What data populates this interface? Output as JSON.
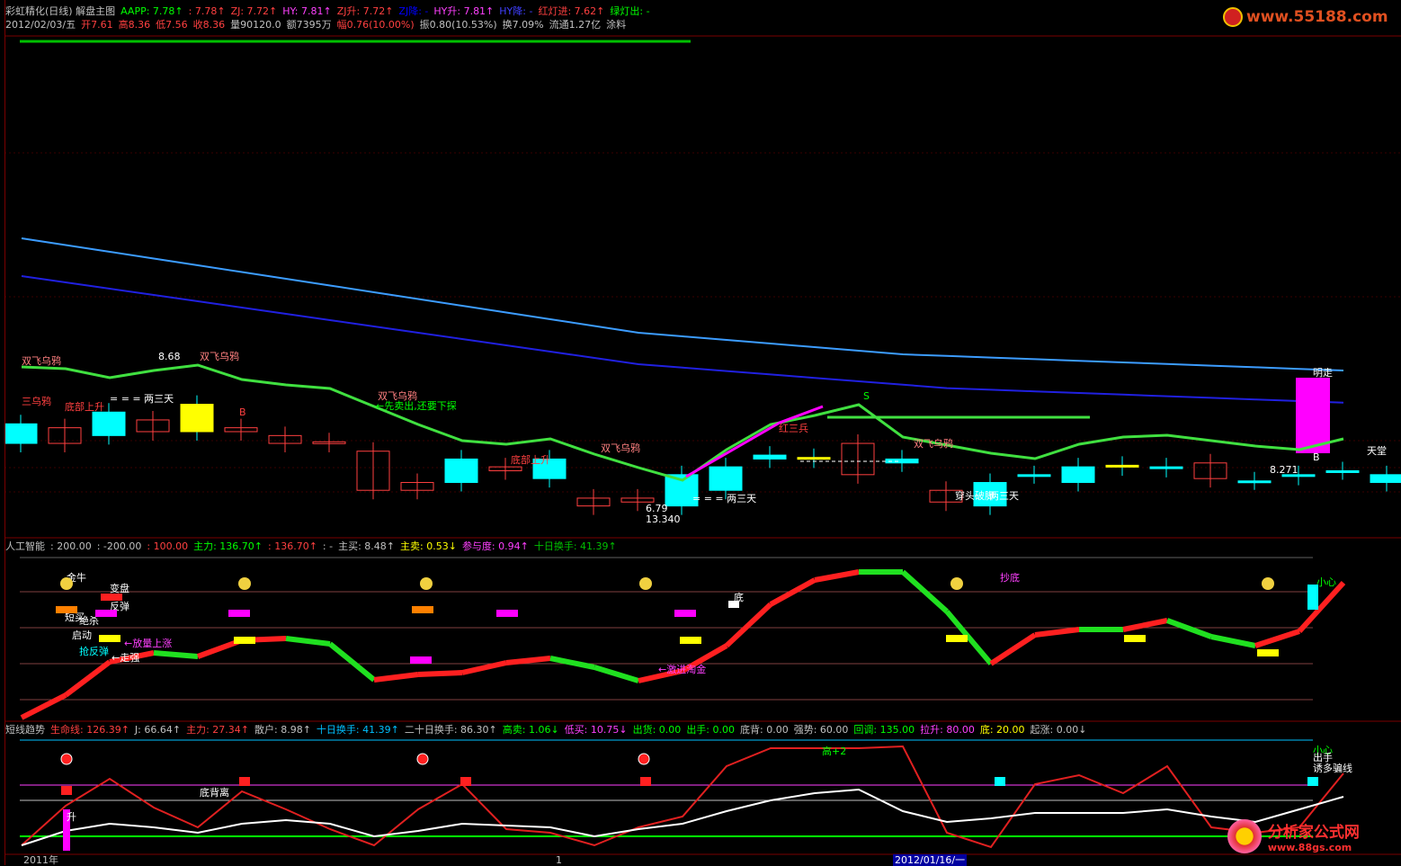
{
  "header": {
    "row1": [
      {
        "text": "彩虹精化(日线) 解盘主图",
        "color": "#c0c0c0"
      },
      {
        "text": "AAPP: 7.78↑",
        "color": "#00ff00"
      },
      {
        "text": ": 7.78↑",
        "color": "#ff4040"
      },
      {
        "text": "ZJ: 7.72↑",
        "color": "#ff4040"
      },
      {
        "text": "HY: 7.81↑",
        "color": "#ff40ff"
      },
      {
        "text": "ZJ升: 7.72↑",
        "color": "#ff4040"
      },
      {
        "text": "ZJ降: -",
        "color": "#0000ff"
      },
      {
        "text": "HY升: 7.81↑",
        "color": "#ff40ff"
      },
      {
        "text": "HY降: -",
        "color": "#4040ff"
      },
      {
        "text": "红灯进: 7.62↑",
        "color": "#ff4040"
      },
      {
        "text": "绿灯出: -",
        "color": "#00ff00"
      }
    ],
    "row2": [
      {
        "text": "2012/02/03/五",
        "color": "#c0c0c0"
      },
      {
        "text": "开7.61",
        "color": "#ff4040"
      },
      {
        "text": "高8.36",
        "color": "#ff4040"
      },
      {
        "text": "低7.56",
        "color": "#ff4040"
      },
      {
        "text": "收8.36",
        "color": "#ff4040"
      },
      {
        "text": "量90120.0",
        "color": "#c0c0c0"
      },
      {
        "text": "额7395万",
        "color": "#c0c0c0"
      },
      {
        "text": "幅0.76(10.00%)",
        "color": "#ff4040"
      },
      {
        "text": "振0.80(10.53%)",
        "color": "#c0c0c0"
      },
      {
        "text": "换7.09%",
        "color": "#c0c0c0"
      },
      {
        "text": "流通1.27亿",
        "color": "#c0c0c0"
      },
      {
        "text": "涂料",
        "color": "#c0c0c0"
      }
    ]
  },
  "panel2_header": [
    {
      "text": "人工智能",
      "color": "#c0c0c0"
    },
    {
      "text": ": 200.00",
      "color": "#c0c0c0"
    },
    {
      "text": ": -200.00",
      "color": "#c0c0c0"
    },
    {
      "text": ": 100.00",
      "color": "#ff4040"
    },
    {
      "text": "主力: 136.70↑",
      "color": "#00ff00"
    },
    {
      "text": ": 136.70↑",
      "color": "#ff4040"
    },
    {
      "text": ": -",
      "color": "#c0c0c0"
    },
    {
      "text": "主买: 8.48↑",
      "color": "#c0c0c0"
    },
    {
      "text": "主卖: 0.53↓",
      "color": "#ffff00"
    },
    {
      "text": "参与度: 0.94↑",
      "color": "#ff40ff"
    },
    {
      "text": "十日换手: 41.39↑",
      "color": "#00c000"
    }
  ],
  "panel3_header": [
    {
      "text": "短线趋势",
      "color": "#c0c0c0"
    },
    {
      "text": "生命线: 126.39↑",
      "color": "#ff4040"
    },
    {
      "text": "J: 66.64↑",
      "color": "#c0c0c0"
    },
    {
      "text": "主力: 27.34↑",
      "color": "#ff4040"
    },
    {
      "text": "散户: 8.98↑",
      "color": "#c0c0c0"
    },
    {
      "text": "十日换手: 41.39↑",
      "color": "#00c0ff"
    },
    {
      "text": "二十日换手: 86.30↑",
      "color": "#c0c0c0"
    },
    {
      "text": "高卖: 1.06↓",
      "color": "#00ff00"
    },
    {
      "text": "低买: 10.75↓",
      "color": "#ff40ff"
    },
    {
      "text": "出货: 0.00",
      "color": "#00ff00"
    },
    {
      "text": "出手: 0.00",
      "color": "#00ff00"
    },
    {
      "text": "底背: 0.00",
      "color": "#c0c0c0"
    },
    {
      "text": "强势: 60.00",
      "color": "#c0c0c0"
    },
    {
      "text": "回调: 135.00",
      "color": "#00ff00"
    },
    {
      "text": "拉升: 80.00",
      "color": "#ff40ff"
    },
    {
      "text": "底: 20.00",
      "color": "#ffff00"
    },
    {
      "text": "起涨: 0.00↓",
      "color": "#c0c0c0"
    }
  ],
  "watermark_top": "www.55188.com",
  "watermark_bottom": {
    "cn": "分析家公式网",
    "url": "www.88gs.com"
  },
  "axis_labels": {
    "left": "2011年",
    "mid": "1",
    "date": "2012/01/16/一"
  },
  "chart_data": {
    "type": "candlestick",
    "candles": [
      {
        "o": 7.6,
        "c": 7.85
      },
      {
        "o": 7.8,
        "c": 7.6
      },
      {
        "o": 7.7,
        "c": 8.0
      },
      {
        "o": 7.9,
        "c": 7.75
      },
      {
        "o": 7.75,
        "c": 8.1
      },
      {
        "o": 7.8,
        "c": 7.75
      },
      {
        "o": 7.7,
        "c": 7.6
      },
      {
        "o": 7.62,
        "c": 7.6
      },
      {
        "o": 7.5,
        "c": 7.0
      },
      {
        "o": 7.1,
        "c": 7.0
      },
      {
        "o": 7.1,
        "c": 7.4
      },
      {
        "o": 7.3,
        "c": 7.25
      },
      {
        "o": 7.15,
        "c": 7.4
      },
      {
        "o": 6.9,
        "c": 6.8
      },
      {
        "o": 6.9,
        "c": 6.85
      },
      {
        "o": 6.8,
        "c": 7.2
      },
      {
        "o": 7.0,
        "c": 7.3
      },
      {
        "o": 7.4,
        "c": 7.45
      },
      {
        "o": 7.4,
        "c": 7.42
      },
      {
        "o": 7.6,
        "c": 7.2
      },
      {
        "o": 7.35,
        "c": 7.4
      },
      {
        "o": 7.0,
        "c": 6.85
      },
      {
        "o": 6.8,
        "c": 7.1
      },
      {
        "o": 7.2,
        "c": 7.2
      },
      {
        "o": 7.1,
        "c": 7.3
      },
      {
        "o": 7.3,
        "c": 7.32
      },
      {
        "o": 7.28,
        "c": 7.3
      },
      {
        "o": 7.35,
        "c": 7.15
      },
      {
        "o": 7.12,
        "c": 7.12
      },
      {
        "o": 7.18,
        "c": 7.2
      },
      {
        "o": 7.25,
        "c": 7.25
      },
      {
        "o": 7.1,
        "c": 7.2
      },
      {
        "o": 7.2,
        "c": 7.75
      }
    ],
    "labels": [
      {
        "text": "双飞乌鸦",
        "color": "#ff8080"
      },
      {
        "text": "三乌鸦",
        "color": "#ff4040"
      },
      {
        "text": "底部上升",
        "color": "#ff4040"
      },
      {
        "text": "= = = 两三天",
        "color": "#ffffff"
      },
      {
        "text": "8.68",
        "color": "#ffffff"
      },
      {
        "text": "双飞乌鸦",
        "color": "#ff8080"
      },
      {
        "text": "B",
        "color": "#ff4040"
      },
      {
        "text": "双飞乌鸦",
        "color": "#ff8080"
      },
      {
        "text": "←先卖出,还要下探",
        "color": "#00ff00"
      },
      {
        "text": "底部上升",
        "color": "#ff4040"
      },
      {
        "text": "双飞乌鸦",
        "color": "#ff8080"
      },
      {
        "text": "6.79",
        "color": "#ffffff"
      },
      {
        "text": "13.340",
        "color": "#ffffff"
      },
      {
        "text": "= = = 两三天",
        "color": "#ffffff"
      },
      {
        "text": "红三兵",
        "color": "#ff4040"
      },
      {
        "text": "S",
        "color": "#00ff00"
      },
      {
        "text": "双飞乌鸦",
        "color": "#ff8080"
      },
      {
        "text": "穿头破脚",
        "color": "#ffffff"
      },
      {
        "text": "两三天",
        "color": "#ffffff"
      },
      {
        "text": "8.271",
        "color": "#ffffff"
      },
      {
        "text": "明走",
        "color": "#ffffff"
      },
      {
        "text": "天堂",
        "color": "#ffffff"
      },
      {
        "text": "B",
        "color": "#ffffff"
      }
    ],
    "panel2_labels": [
      {
        "text": "金牛",
        "color": "#ffffff"
      },
      {
        "text": "变盘",
        "color": "#ffffff"
      },
      {
        "text": "反弹",
        "color": "#ffffff"
      },
      {
        "text": "短买",
        "color": "#ffffff"
      },
      {
        "text": "绝杀",
        "color": "#ffffff"
      },
      {
        "text": "启动",
        "color": "#ffffff"
      },
      {
        "text": "抢反弹",
        "color": "#00ffff"
      },
      {
        "text": "←放量上涨",
        "color": "#ff40ff"
      },
      {
        "text": "←走强",
        "color": "#ffffff"
      },
      {
        "text": "←激进淘金",
        "color": "#ff40ff"
      },
      {
        "text": "底",
        "color": "#ffffff"
      },
      {
        "text": "抄底",
        "color": "#ff40ff"
      },
      {
        "text": "小心",
        "color": "#00ff00"
      }
    ],
    "panel3_labels": [
      {
        "text": "底背离",
        "color": "#ffffff"
      },
      {
        "text": "高+2",
        "color": "#00ff00"
      },
      {
        "text": "小心",
        "color": "#00ff00"
      },
      {
        "text": "出手",
        "color": "#ffffff"
      },
      {
        "text": "诱多骗线",
        "color": "#ffffff"
      },
      {
        "text": "升",
        "color": "#ffffff"
      }
    ]
  }
}
